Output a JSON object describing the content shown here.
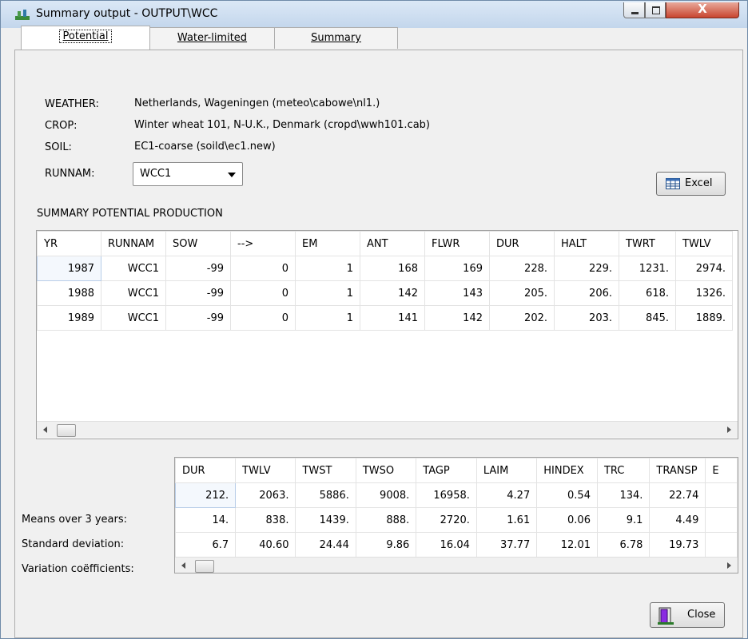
{
  "window": {
    "title": "Summary output - OUTPUT\\WCC",
    "close_glyph": "X"
  },
  "tabs": [
    {
      "label": "Potential",
      "active": true
    },
    {
      "label": "Water-limited",
      "active": false
    },
    {
      "label": "Summary",
      "active": false
    }
  ],
  "info": {
    "weather_label": "WEATHER:",
    "weather_value": "Netherlands, Wageningen (meteo\\cabowe\\nl1.)",
    "crop_label": "CROP:",
    "crop_value": "Winter wheat 101, N-U.K., Denmark (cropd\\wwh101.cab)",
    "soil_label": "SOIL:",
    "soil_value": "EC1-coarse (soild\\ec1.new)",
    "runnam_label": "RUNNAM:",
    "runnam_value": "WCC1"
  },
  "buttons": {
    "excel": "Excel",
    "close": "Close"
  },
  "summary_title": "SUMMARY POTENTIAL PRODUCTION",
  "production_table": {
    "columns": [
      "YR",
      "RUNNAM",
      "SOW",
      "-->",
      "EM",
      "ANT",
      "FLWR",
      "DUR",
      "HALT",
      "TWRT",
      "TWLV"
    ],
    "rows": [
      [
        "1987",
        "WCC1",
        "-99",
        "0",
        "1",
        "168",
        "169",
        "228.",
        "229.",
        "1231.",
        "2974."
      ],
      [
        "1988",
        "WCC1",
        "-99",
        "0",
        "1",
        "142",
        "143",
        "205.",
        "206.",
        "618.",
        "1326."
      ],
      [
        "1989",
        "WCC1",
        "-99",
        "0",
        "1",
        "141",
        "142",
        "202.",
        "203.",
        "845.",
        "1889."
      ]
    ]
  },
  "stats_table": {
    "columns": [
      "DUR",
      "TWLV",
      "TWST",
      "TWSO",
      "TAGP",
      "LAIM",
      "HINDEX",
      "TRC",
      "TRANSP",
      "E"
    ],
    "row_labels": [
      "Means over 3 years:",
      "Standard deviation:",
      "Variation coëfficients:"
    ],
    "rows": [
      [
        "212.",
        "2063.",
        "5886.",
        "9008.",
        "16958.",
        "4.27",
        "0.54",
        "134.",
        "22.74",
        ""
      ],
      [
        "14.",
        "838.",
        "1439.",
        "888.",
        "2720.",
        "1.61",
        "0.06",
        "9.1",
        "4.49",
        ""
      ],
      [
        "6.7",
        "40.60",
        "24.44",
        "9.86",
        "16.04",
        "37.77",
        "12.01",
        "6.78",
        "19.73",
        ""
      ]
    ]
  }
}
